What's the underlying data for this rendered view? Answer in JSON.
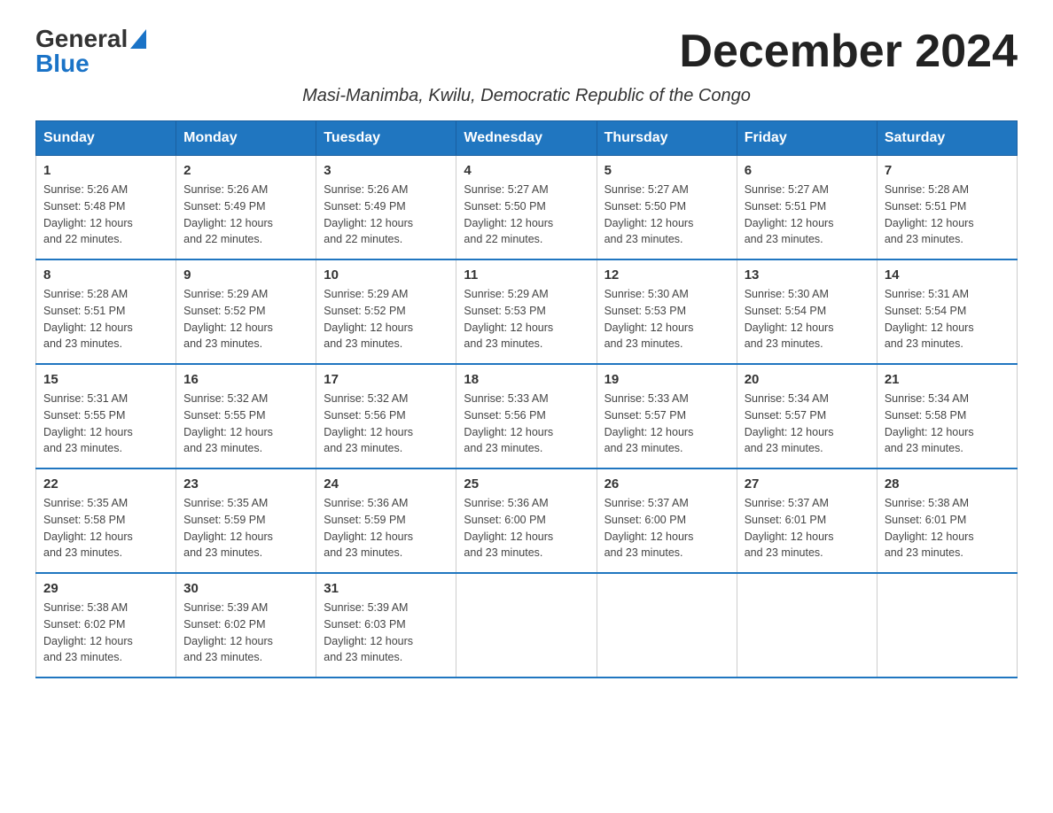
{
  "logo": {
    "general": "General",
    "blue": "Blue"
  },
  "title": "December 2024",
  "subtitle": "Masi-Manimba, Kwilu, Democratic Republic of the Congo",
  "days_of_week": [
    "Sunday",
    "Monday",
    "Tuesday",
    "Wednesday",
    "Thursday",
    "Friday",
    "Saturday"
  ],
  "weeks": [
    [
      {
        "day": "1",
        "sunrise": "5:26 AM",
        "sunset": "5:48 PM",
        "daylight": "12 hours and 22 minutes."
      },
      {
        "day": "2",
        "sunrise": "5:26 AM",
        "sunset": "5:49 PM",
        "daylight": "12 hours and 22 minutes."
      },
      {
        "day": "3",
        "sunrise": "5:26 AM",
        "sunset": "5:49 PM",
        "daylight": "12 hours and 22 minutes."
      },
      {
        "day": "4",
        "sunrise": "5:27 AM",
        "sunset": "5:50 PM",
        "daylight": "12 hours and 22 minutes."
      },
      {
        "day": "5",
        "sunrise": "5:27 AM",
        "sunset": "5:50 PM",
        "daylight": "12 hours and 23 minutes."
      },
      {
        "day": "6",
        "sunrise": "5:27 AM",
        "sunset": "5:51 PM",
        "daylight": "12 hours and 23 minutes."
      },
      {
        "day": "7",
        "sunrise": "5:28 AM",
        "sunset": "5:51 PM",
        "daylight": "12 hours and 23 minutes."
      }
    ],
    [
      {
        "day": "8",
        "sunrise": "5:28 AM",
        "sunset": "5:51 PM",
        "daylight": "12 hours and 23 minutes."
      },
      {
        "day": "9",
        "sunrise": "5:29 AM",
        "sunset": "5:52 PM",
        "daylight": "12 hours and 23 minutes."
      },
      {
        "day": "10",
        "sunrise": "5:29 AM",
        "sunset": "5:52 PM",
        "daylight": "12 hours and 23 minutes."
      },
      {
        "day": "11",
        "sunrise": "5:29 AM",
        "sunset": "5:53 PM",
        "daylight": "12 hours and 23 minutes."
      },
      {
        "day": "12",
        "sunrise": "5:30 AM",
        "sunset": "5:53 PM",
        "daylight": "12 hours and 23 minutes."
      },
      {
        "day": "13",
        "sunrise": "5:30 AM",
        "sunset": "5:54 PM",
        "daylight": "12 hours and 23 minutes."
      },
      {
        "day": "14",
        "sunrise": "5:31 AM",
        "sunset": "5:54 PM",
        "daylight": "12 hours and 23 minutes."
      }
    ],
    [
      {
        "day": "15",
        "sunrise": "5:31 AM",
        "sunset": "5:55 PM",
        "daylight": "12 hours and 23 minutes."
      },
      {
        "day": "16",
        "sunrise": "5:32 AM",
        "sunset": "5:55 PM",
        "daylight": "12 hours and 23 minutes."
      },
      {
        "day": "17",
        "sunrise": "5:32 AM",
        "sunset": "5:56 PM",
        "daylight": "12 hours and 23 minutes."
      },
      {
        "day": "18",
        "sunrise": "5:33 AM",
        "sunset": "5:56 PM",
        "daylight": "12 hours and 23 minutes."
      },
      {
        "day": "19",
        "sunrise": "5:33 AM",
        "sunset": "5:57 PM",
        "daylight": "12 hours and 23 minutes."
      },
      {
        "day": "20",
        "sunrise": "5:34 AM",
        "sunset": "5:57 PM",
        "daylight": "12 hours and 23 minutes."
      },
      {
        "day": "21",
        "sunrise": "5:34 AM",
        "sunset": "5:58 PM",
        "daylight": "12 hours and 23 minutes."
      }
    ],
    [
      {
        "day": "22",
        "sunrise": "5:35 AM",
        "sunset": "5:58 PM",
        "daylight": "12 hours and 23 minutes."
      },
      {
        "day": "23",
        "sunrise": "5:35 AM",
        "sunset": "5:59 PM",
        "daylight": "12 hours and 23 minutes."
      },
      {
        "day": "24",
        "sunrise": "5:36 AM",
        "sunset": "5:59 PM",
        "daylight": "12 hours and 23 minutes."
      },
      {
        "day": "25",
        "sunrise": "5:36 AM",
        "sunset": "6:00 PM",
        "daylight": "12 hours and 23 minutes."
      },
      {
        "day": "26",
        "sunrise": "5:37 AM",
        "sunset": "6:00 PM",
        "daylight": "12 hours and 23 minutes."
      },
      {
        "day": "27",
        "sunrise": "5:37 AM",
        "sunset": "6:01 PM",
        "daylight": "12 hours and 23 minutes."
      },
      {
        "day": "28",
        "sunrise": "5:38 AM",
        "sunset": "6:01 PM",
        "daylight": "12 hours and 23 minutes."
      }
    ],
    [
      {
        "day": "29",
        "sunrise": "5:38 AM",
        "sunset": "6:02 PM",
        "daylight": "12 hours and 23 minutes."
      },
      {
        "day": "30",
        "sunrise": "5:39 AM",
        "sunset": "6:02 PM",
        "daylight": "12 hours and 23 minutes."
      },
      {
        "day": "31",
        "sunrise": "5:39 AM",
        "sunset": "6:03 PM",
        "daylight": "12 hours and 23 minutes."
      },
      {
        "day": "",
        "sunrise": "",
        "sunset": "",
        "daylight": ""
      },
      {
        "day": "",
        "sunrise": "",
        "sunset": "",
        "daylight": ""
      },
      {
        "day": "",
        "sunrise": "",
        "sunset": "",
        "daylight": ""
      },
      {
        "day": "",
        "sunrise": "",
        "sunset": "",
        "daylight": ""
      }
    ]
  ],
  "labels": {
    "sunrise_prefix": "Sunrise: ",
    "sunset_prefix": "Sunset: ",
    "daylight_prefix": "Daylight: "
  }
}
